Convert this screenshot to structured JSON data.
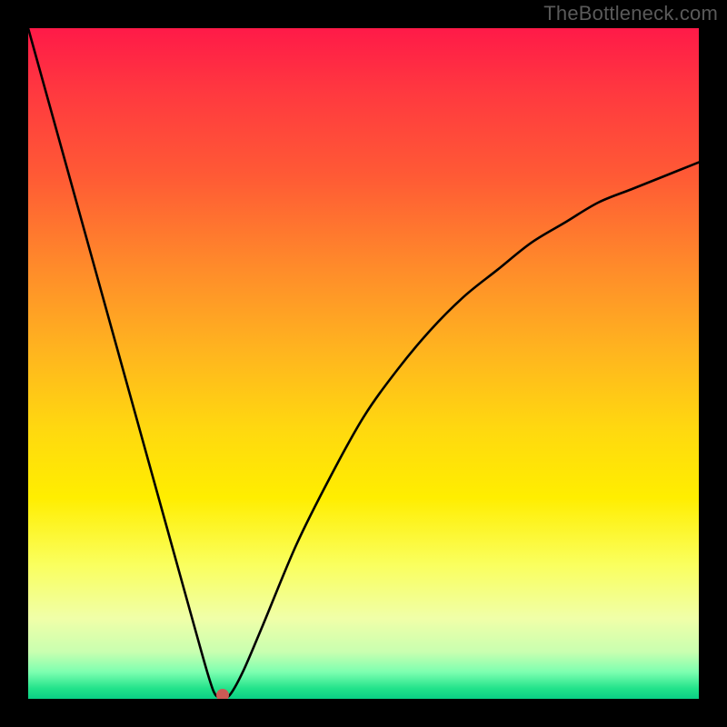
{
  "watermark": "TheBottleneck.com",
  "chart_data": {
    "type": "line",
    "title": "",
    "xlabel": "",
    "ylabel": "",
    "xlim": [
      0,
      100
    ],
    "ylim": [
      0,
      100
    ],
    "grid": false,
    "legend": "none",
    "series": [
      {
        "name": "curve",
        "x": [
          0,
          5,
          10,
          15,
          20,
          25,
          27,
          28,
          29,
          30,
          32,
          35,
          40,
          45,
          50,
          55,
          60,
          65,
          70,
          75,
          80,
          85,
          90,
          95,
          100
        ],
        "y": [
          100,
          82,
          64,
          46,
          28,
          10,
          3,
          0.5,
          0.5,
          0.5,
          4,
          11,
          23,
          33,
          42,
          49,
          55,
          60,
          64,
          68,
          71,
          74,
          76,
          78,
          80
        ]
      }
    ],
    "minimum_point": {
      "x": 29,
      "y": 0.5
    },
    "colors": {
      "gradient_top": "#ff1a48",
      "gradient_mid": "#ffd90f",
      "gradient_bottom": "#0acf85",
      "curve": "#000000",
      "dot": "#cc5a55",
      "frame": "#000000"
    }
  }
}
